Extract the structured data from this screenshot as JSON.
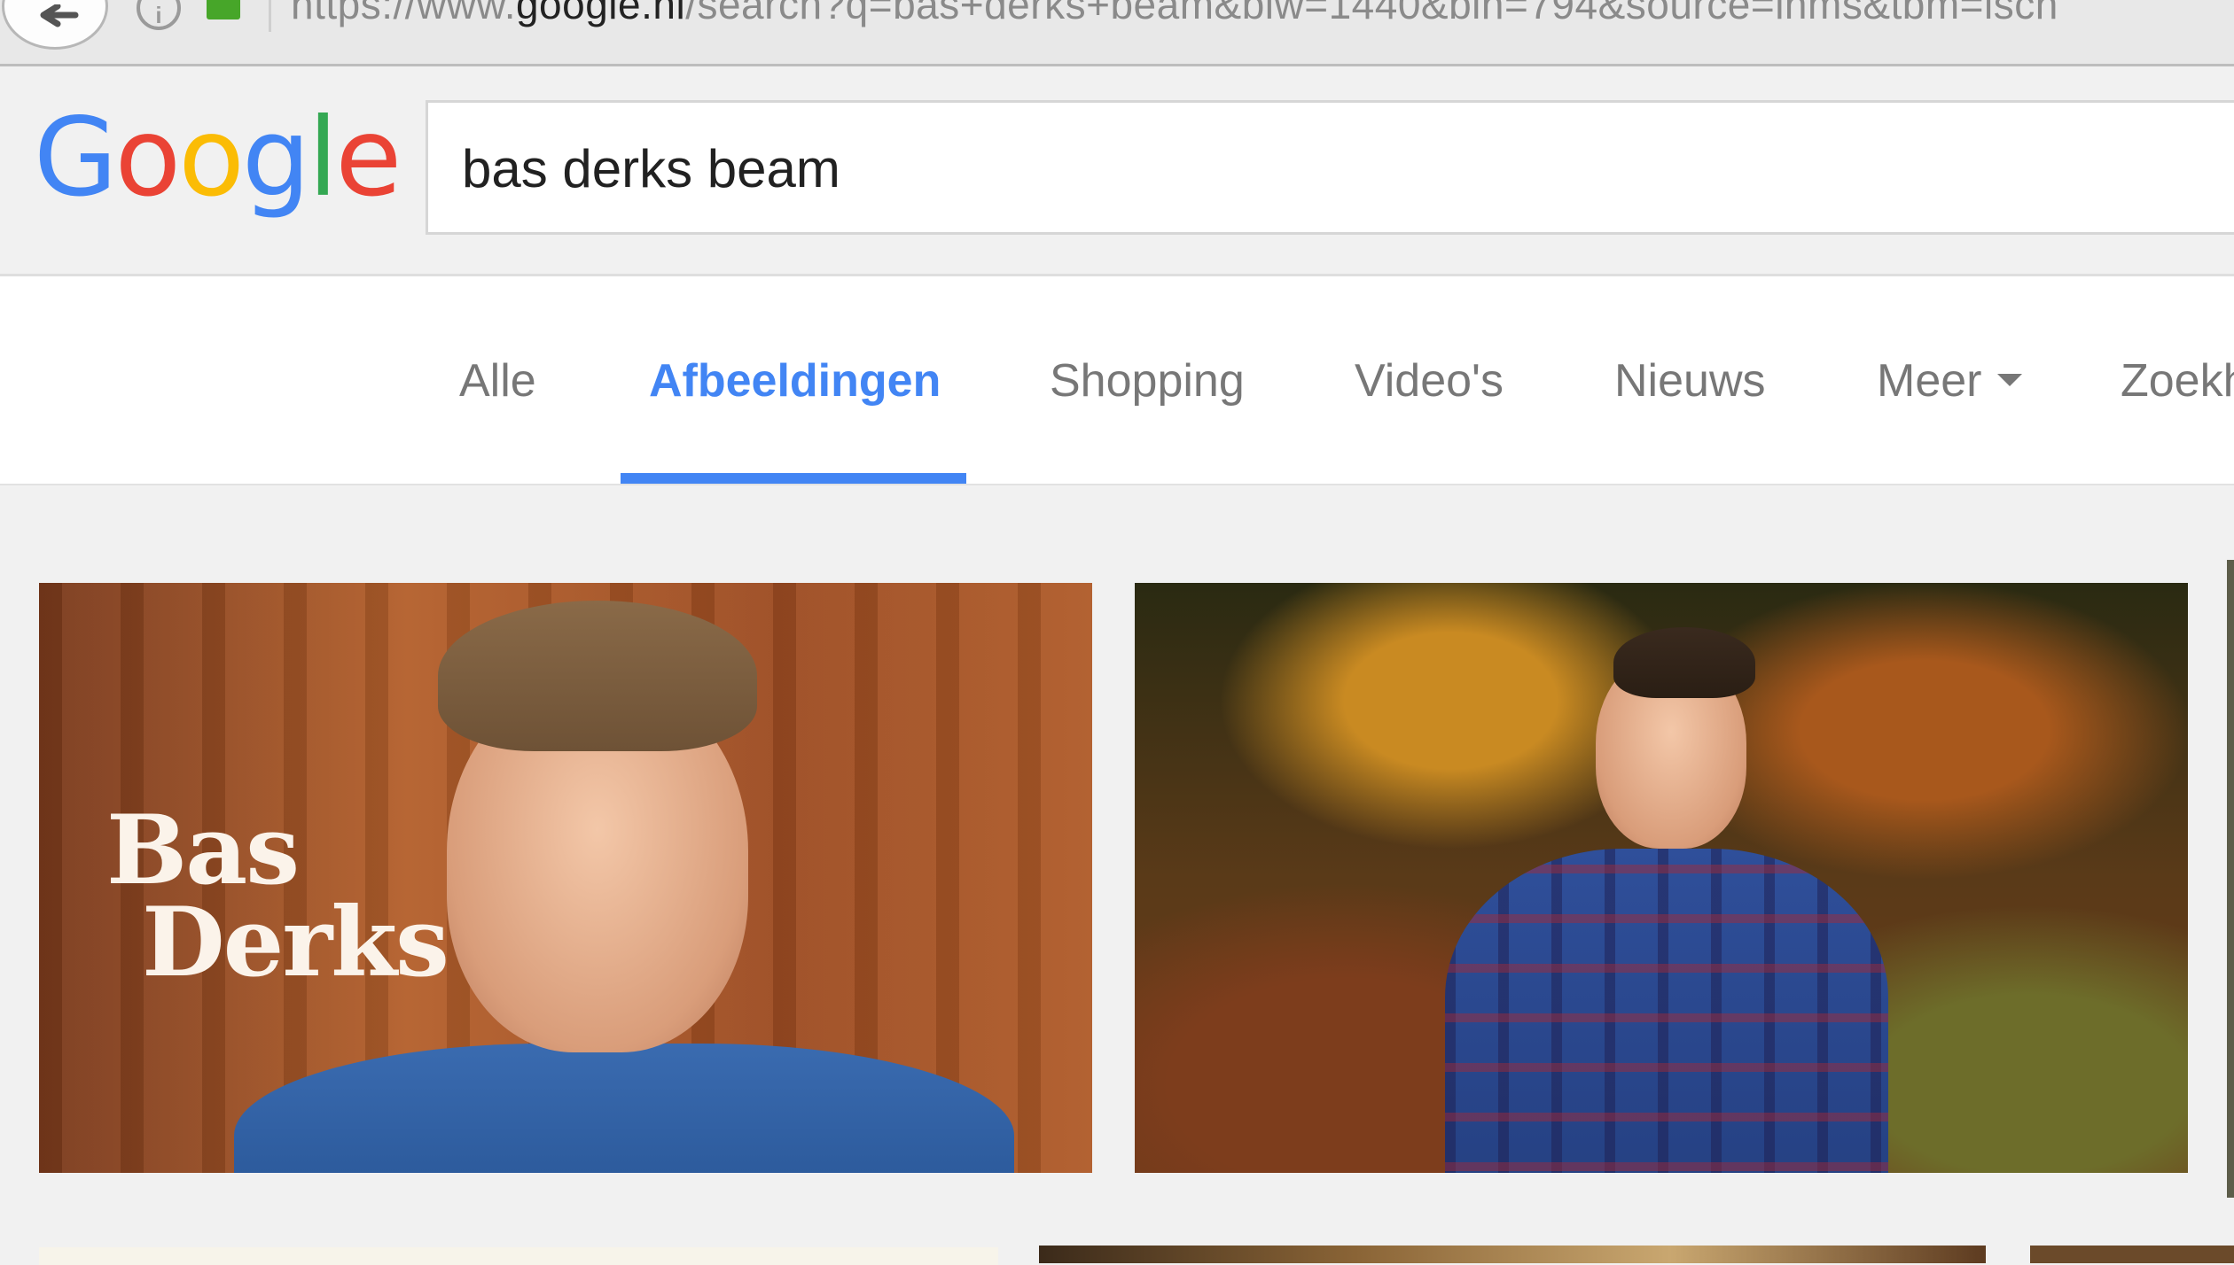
{
  "browser": {
    "url_prefix": "https://www.",
    "url_host": "google.nl",
    "url_path": "/search?q=bas+derks+beam&biw=1440&bih=794&source=lnms&tbm=isch"
  },
  "logo": {
    "letters": [
      "G",
      "o",
      "o",
      "g",
      "l",
      "e"
    ],
    "colors": [
      "#4285f4",
      "#ea4335",
      "#fbbc05",
      "#4285f4",
      "#34a853",
      "#ea4335"
    ]
  },
  "search": {
    "query": "bas derks beam"
  },
  "tabs": [
    {
      "label": "Alle"
    },
    {
      "label": "Afbeeldingen",
      "active": true
    },
    {
      "label": "Shopping"
    },
    {
      "label": "Video's"
    },
    {
      "label": "Nieuws"
    },
    {
      "label": "Meer"
    },
    {
      "label": "Zoekh"
    }
  ],
  "accent_color": "#4285f4",
  "results": {
    "image1_overlay_line1": "Bas",
    "image1_overlay_line2": "Derks"
  },
  "icons": [
    "back-arrow-icon",
    "info-icon",
    "lock-icon",
    "caret-down-icon"
  ]
}
